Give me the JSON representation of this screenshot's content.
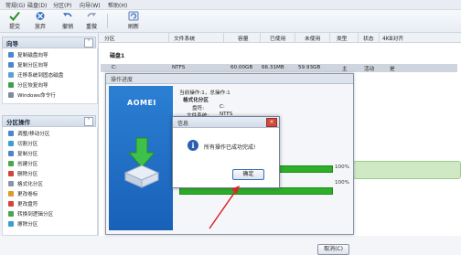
{
  "menubar": {
    "items": [
      "常规(G)",
      "磁盘(D)",
      "分区(P)",
      "向导(W)",
      "帮助(H)"
    ]
  },
  "toolbar": {
    "buttons": [
      {
        "label": "提交",
        "icon": "check-icon"
      },
      {
        "label": "放弃",
        "icon": "discard-icon"
      },
      {
        "label": "撤销",
        "icon": "undo-icon"
      },
      {
        "label": "重做",
        "icon": "redo-icon"
      },
      {
        "label": "刷新",
        "icon": "refresh-icon"
      }
    ]
  },
  "sidebar": {
    "wizard_header": "向导",
    "wizard_items": [
      "复制磁盘向导",
      "复制分区向导",
      "迁移系统到固态磁盘",
      "分区恢复向导",
      "Windows命令行"
    ],
    "ops_header": "分区操作",
    "ops_items": [
      "调整/移动分区",
      "切割分区",
      "复制分区",
      "创建分区",
      "删除分区",
      "格式化分区",
      "更改卷标",
      "更改盘符",
      "转换到逻辑分区",
      "擦除分区"
    ]
  },
  "grid": {
    "columns": [
      "分区",
      "文件系统",
      "容量",
      "已使用",
      "未使用",
      "类型",
      "状态",
      "4KB对齐"
    ],
    "disk_label": "磁盘1",
    "row": [
      "C:",
      "NTFS",
      "60.00GB",
      "66.31MB",
      "59.93GB",
      "主",
      "活动",
      "是"
    ]
  },
  "op_window": {
    "title": "操作进度",
    "brand": "AOMEI",
    "info_lines": [
      "当前操作:1，总操作:1",
      "格式化分区",
      "盘符:",
      "C:",
      "文件系统:",
      "NTFS"
    ],
    "progress1_percent": 100,
    "progress1_label": "100%",
    "progress2_percent": 100,
    "progress2_label": "100%",
    "cancel_label": "取消(C)"
  },
  "dialog": {
    "title": "信息",
    "message": "所有操作已成功完成!",
    "ok_label": "确定"
  },
  "colors": {
    "progress": "#2fae2a",
    "brand_panel": "#1f6ec7",
    "annotation_arrow": "#d9262c"
  }
}
